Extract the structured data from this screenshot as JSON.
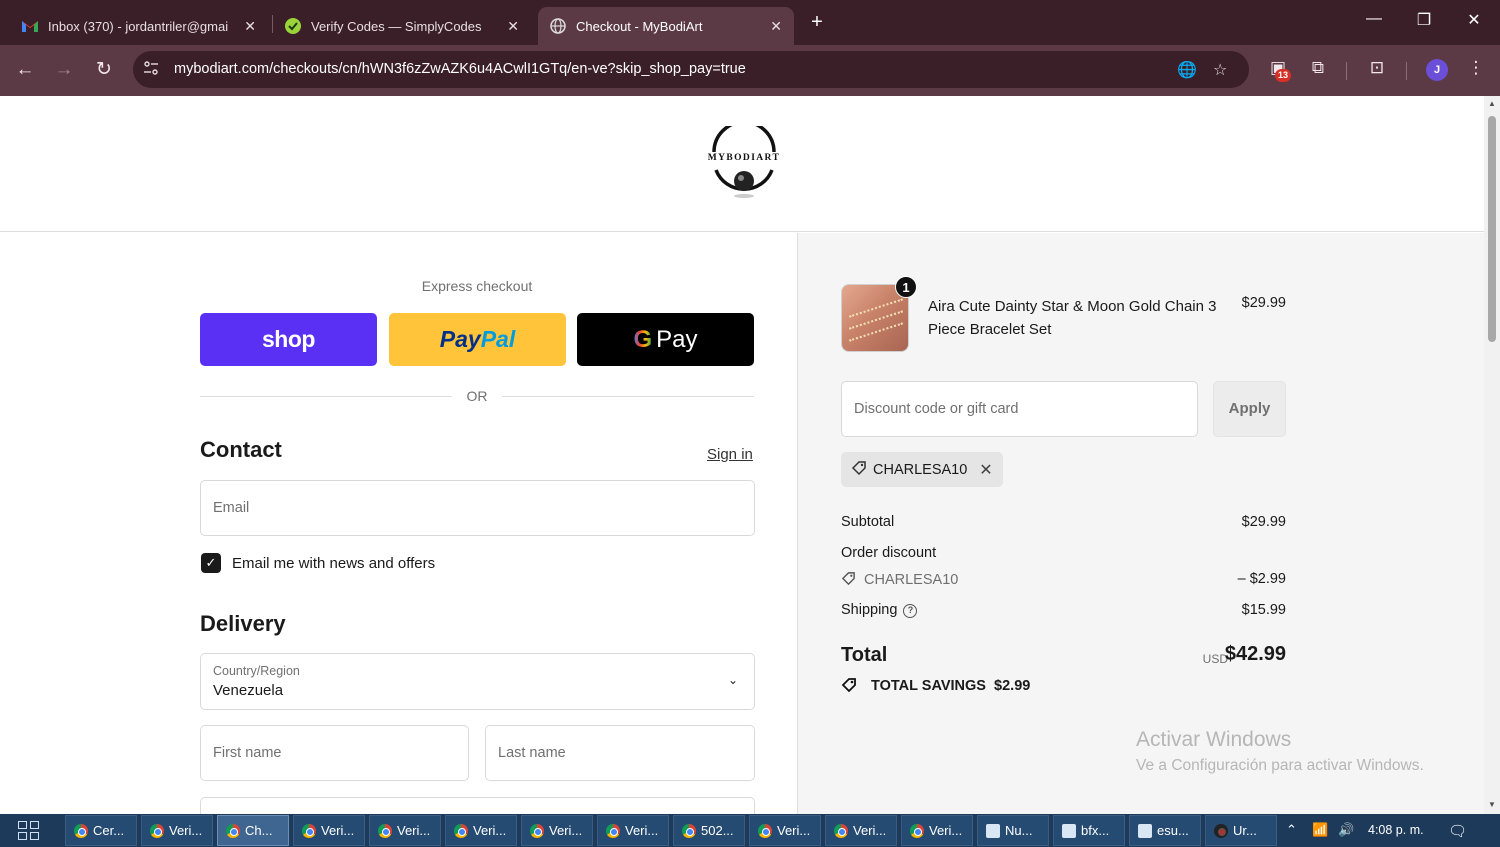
{
  "browser": {
    "tabs": [
      {
        "title": "Inbox (370) - jordantriler@gmai",
        "active": false
      },
      {
        "title": "Verify Codes — SimplyCodes",
        "active": false
      },
      {
        "title": "Checkout - MyBodiArt",
        "active": true
      }
    ],
    "url": "mybodiart.com/checkouts/cn/hWN3f6zZwAZK6u4ACwlI1GTq/en-ve?skip_shop_pay=true",
    "extension_badge": "13",
    "profile_initial": "J"
  },
  "store": {
    "logo_text": "MYBODIART"
  },
  "express": {
    "title": "Express checkout",
    "shop_label": "shop",
    "paypal_label_1": "Pay",
    "paypal_label_2": "Pal",
    "gpay_g": "G",
    "gpay_label": "Pay",
    "or_label": "OR"
  },
  "contact": {
    "heading": "Contact",
    "signin_label": "Sign in",
    "email_placeholder": "Email",
    "newsletter_label": "Email me with news and offers",
    "newsletter_checked": true
  },
  "delivery": {
    "heading": "Delivery",
    "country_label": "Country/Region",
    "country_value": "Venezuela",
    "first_name_placeholder": "First name",
    "last_name_placeholder": "Last name"
  },
  "summary": {
    "product": {
      "name": "Aira Cute Dainty Star & Moon Gold Chain 3 Piece Bracelet Set",
      "price": "$29.99",
      "quantity": "1"
    },
    "discount_placeholder": "Discount code or gift card",
    "apply_label": "Apply",
    "applied_code": "CHARLESA10",
    "subtotal_label": "Subtotal",
    "subtotal_value": "$29.99",
    "order_discount_label": "Order discount",
    "order_discount_code": "CHARLESA10",
    "order_discount_value": "– $2.99",
    "shipping_label": "Shipping",
    "shipping_value": "$15.99",
    "total_label": "Total",
    "total_currency": "USD",
    "total_value": "$42.99",
    "savings_label": "TOTAL SAVINGS",
    "savings_value": "$2.99"
  },
  "watermark": {
    "line1": "Activar Windows",
    "line2": "Ve a Configuración para activar Windows."
  },
  "taskbar": {
    "items": [
      "Cer...",
      "Veri...",
      "Ch...",
      "Veri...",
      "Veri...",
      "Veri...",
      "Veri...",
      "Veri...",
      "502...",
      "Veri...",
      "Veri...",
      "Veri...",
      "Nu...",
      "bfx...",
      "esu...",
      "Ur..."
    ],
    "clock": "4:08 p. m."
  }
}
